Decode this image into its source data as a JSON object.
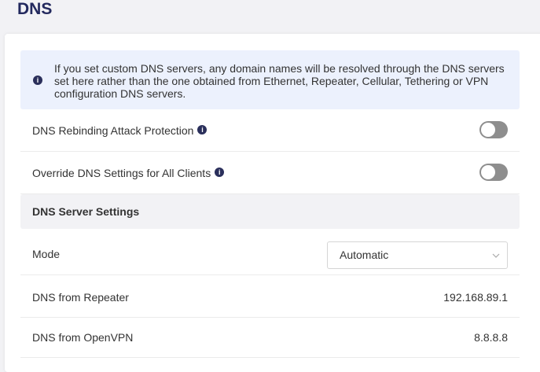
{
  "page": {
    "title": "DNS"
  },
  "banner": {
    "icon": "info-icon",
    "text": "If you set custom DNS servers, any domain names will be resolved through the DNS servers set here rather than the one obtained from Ethernet, Repeater, Cellular, Tethering or VPN configuration DNS servers."
  },
  "settings": {
    "rebinding": {
      "label": "DNS Rebinding Attack Protection",
      "enabled": false
    },
    "override": {
      "label": "Override DNS Settings for All Clients",
      "enabled": false
    }
  },
  "server_settings": {
    "header": "DNS Server Settings",
    "mode": {
      "label": "Mode",
      "selected": "Automatic"
    },
    "repeater": {
      "label": "DNS from Repeater",
      "value": "192.168.89.1"
    },
    "openvpn": {
      "label": "DNS from OpenVPN",
      "value": "8.8.8.8"
    }
  },
  "colors": {
    "title": "#23295e",
    "banner_bg": "#ecf1fd",
    "toggle_off": "#8e8e8e",
    "section_bg": "#f2f2f5"
  }
}
